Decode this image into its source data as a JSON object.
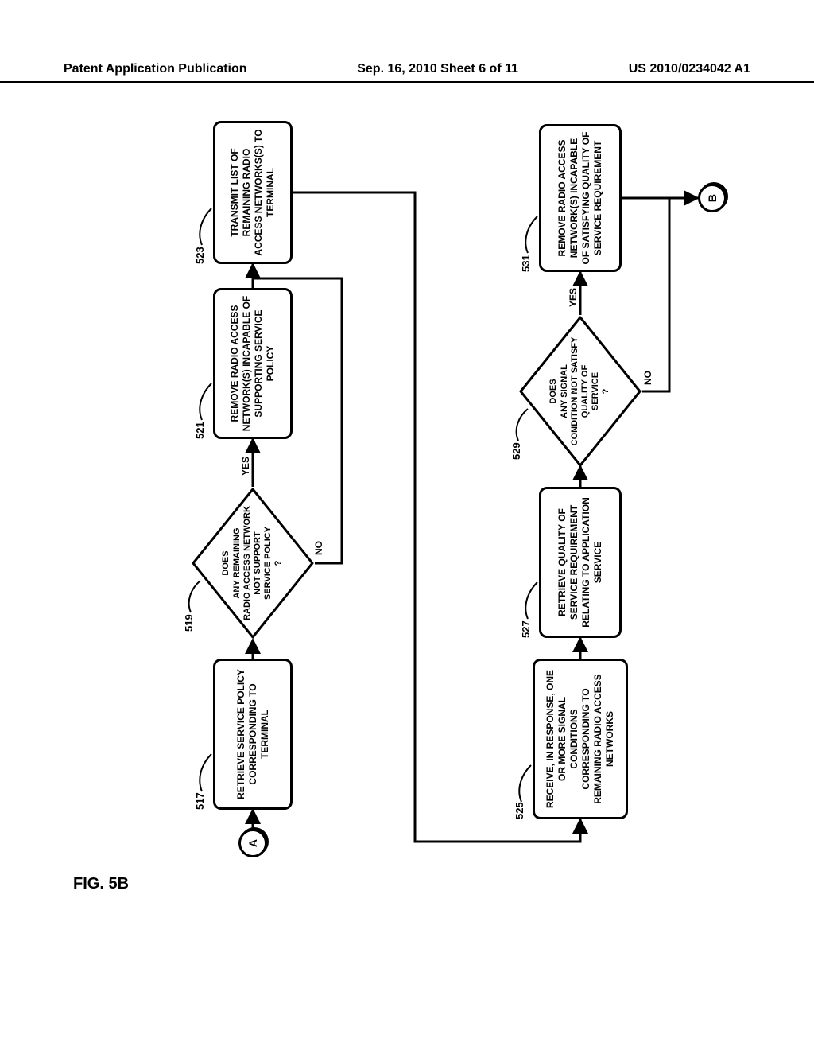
{
  "header": {
    "left": "Patent Application Publication",
    "mid": "Sep. 16, 2010  Sheet 6 of 11",
    "right": "US 2010/0234042 A1"
  },
  "figlabel": "FIG. 5B",
  "connectors": {
    "A": "A",
    "B": "B"
  },
  "refs": {
    "r517": "517",
    "r519": "519",
    "r521": "521",
    "r523": "523",
    "r525": "525",
    "r527": "527",
    "r529": "529",
    "r531": "531"
  },
  "edges": {
    "yes": "YES",
    "no": "NO"
  },
  "boxes": {
    "b517": "RETRIEVE SERVICE POLICY CORRESPONDING TO TERMINAL",
    "b519": "DOES\nANY REMAINING\nRADIO ACCESS NETWORK\nNOT SUPPORT\nSERVICE POLICY\n?",
    "b521": "REMOVE RADIO ACCESS NETWORK(S) INCAPABLE OF SUPPORTING SERVICE POLICY",
    "b523": "TRANSMIT LIST OF REMAINING RADIO ACCESS NETWORKS(S) TO TERMINAL",
    "b525_pre": "RECEIVE, IN RESPONSE, ONE OR MORE SIGNAL CONDITIONS CORRESPONDING TO REMAINING RADIO ACCESS ",
    "b525_net": "NETWORKS",
    "b527": "RETRIEVE QUALITY OF SERVICE REQUIREMENT RELATING TO APPLICATION SERVICE",
    "b529": "DOES\nANY SIGNAL\nCONDITION NOT SATISFY\nQUALITY OF\nSERVICE\n?",
    "b531": "REMOVE RADIO ACCESS NETWORK(S) INCAPABLE OF SATISFYING QUALITY OF SERVICE REQUIREMENT"
  }
}
